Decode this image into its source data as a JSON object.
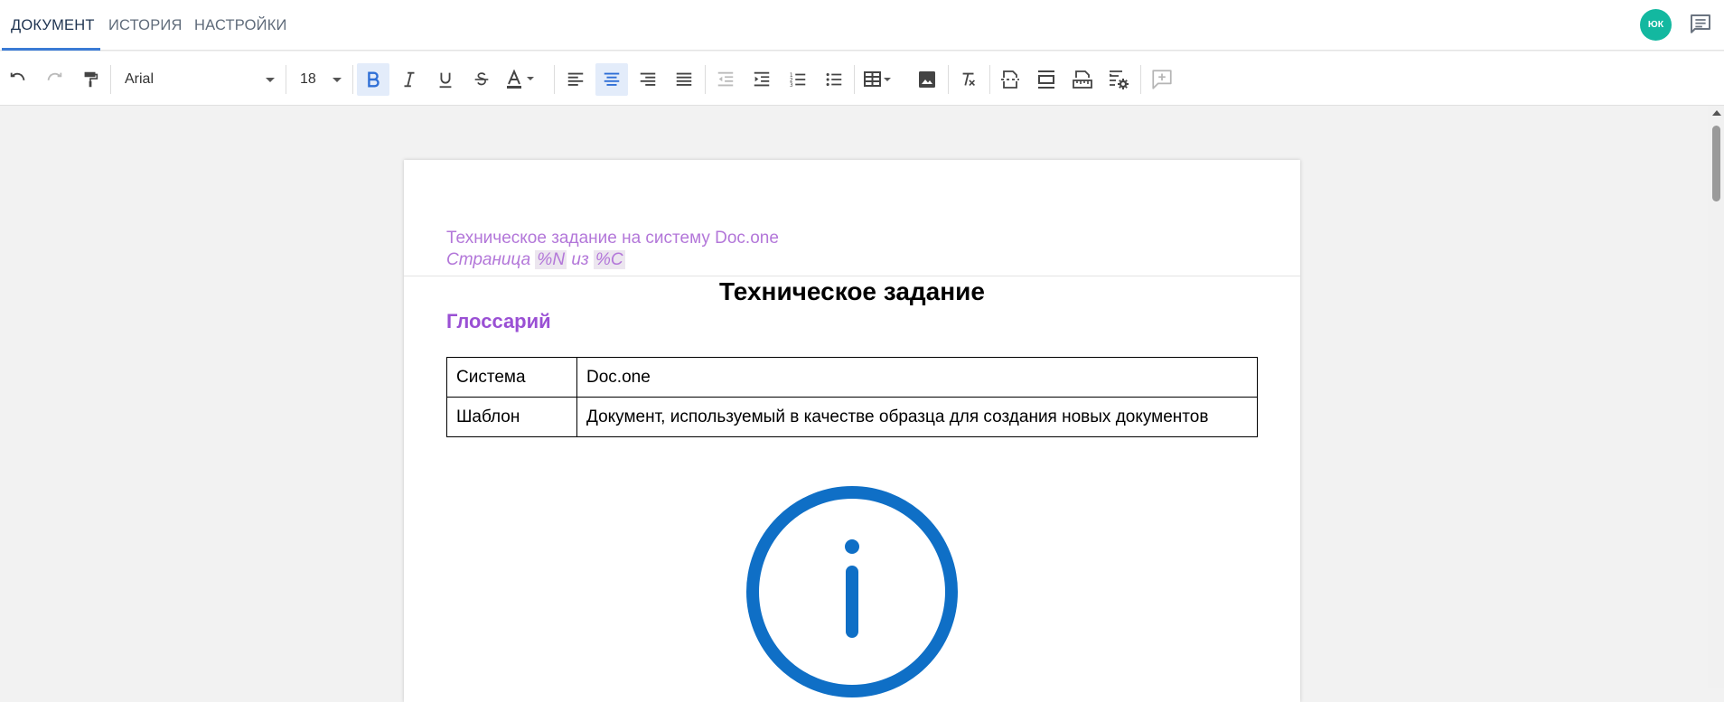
{
  "tabs": [
    {
      "label": "ДОКУМЕНТ"
    },
    {
      "label": "ИСТОРИЯ"
    },
    {
      "label": "НАСТРОЙКИ"
    }
  ],
  "user": {
    "initials": "ЮК"
  },
  "toolbar": {
    "font_family": "Arial",
    "font_size": "18",
    "active": [
      "bold",
      "align-center"
    ],
    "icons": [
      "undo-icon",
      "redo-icon",
      "paint-format-icon",
      "bold-icon",
      "italic-icon",
      "underline-icon",
      "strikethrough-icon",
      "text-color-icon",
      "align-left-icon",
      "align-center-icon",
      "align-right-icon",
      "align-justify-icon",
      "outdent-icon",
      "indent-icon",
      "numbered-list-icon",
      "bulleted-list-icon",
      "table-icon",
      "image-icon",
      "clear-format-icon",
      "page-break-icon",
      "header-footer-icon",
      "ruler-icon",
      "document-settings-icon",
      "add-comment-icon"
    ]
  },
  "document": {
    "header_line": "Техническое задание на систему Doc.one",
    "page_prefix": "Страница",
    "page_field": "%N",
    "page_of": "из",
    "count_field": "%C",
    "title": "Техническое задание",
    "section_heading": "Глоссарий",
    "glossary": [
      {
        "term": "Система",
        "definition": "Doc.one"
      },
      {
        "term": "Шаблон",
        "definition": "Документ, используемый в качестве образца для создания новых документов"
      }
    ]
  },
  "colors": {
    "accent": "#3a7bd5",
    "avatar": "#13b8a0",
    "header_text": "#b377d9",
    "heading": "#9a50d4",
    "info_icon": "#0f6fc6"
  }
}
